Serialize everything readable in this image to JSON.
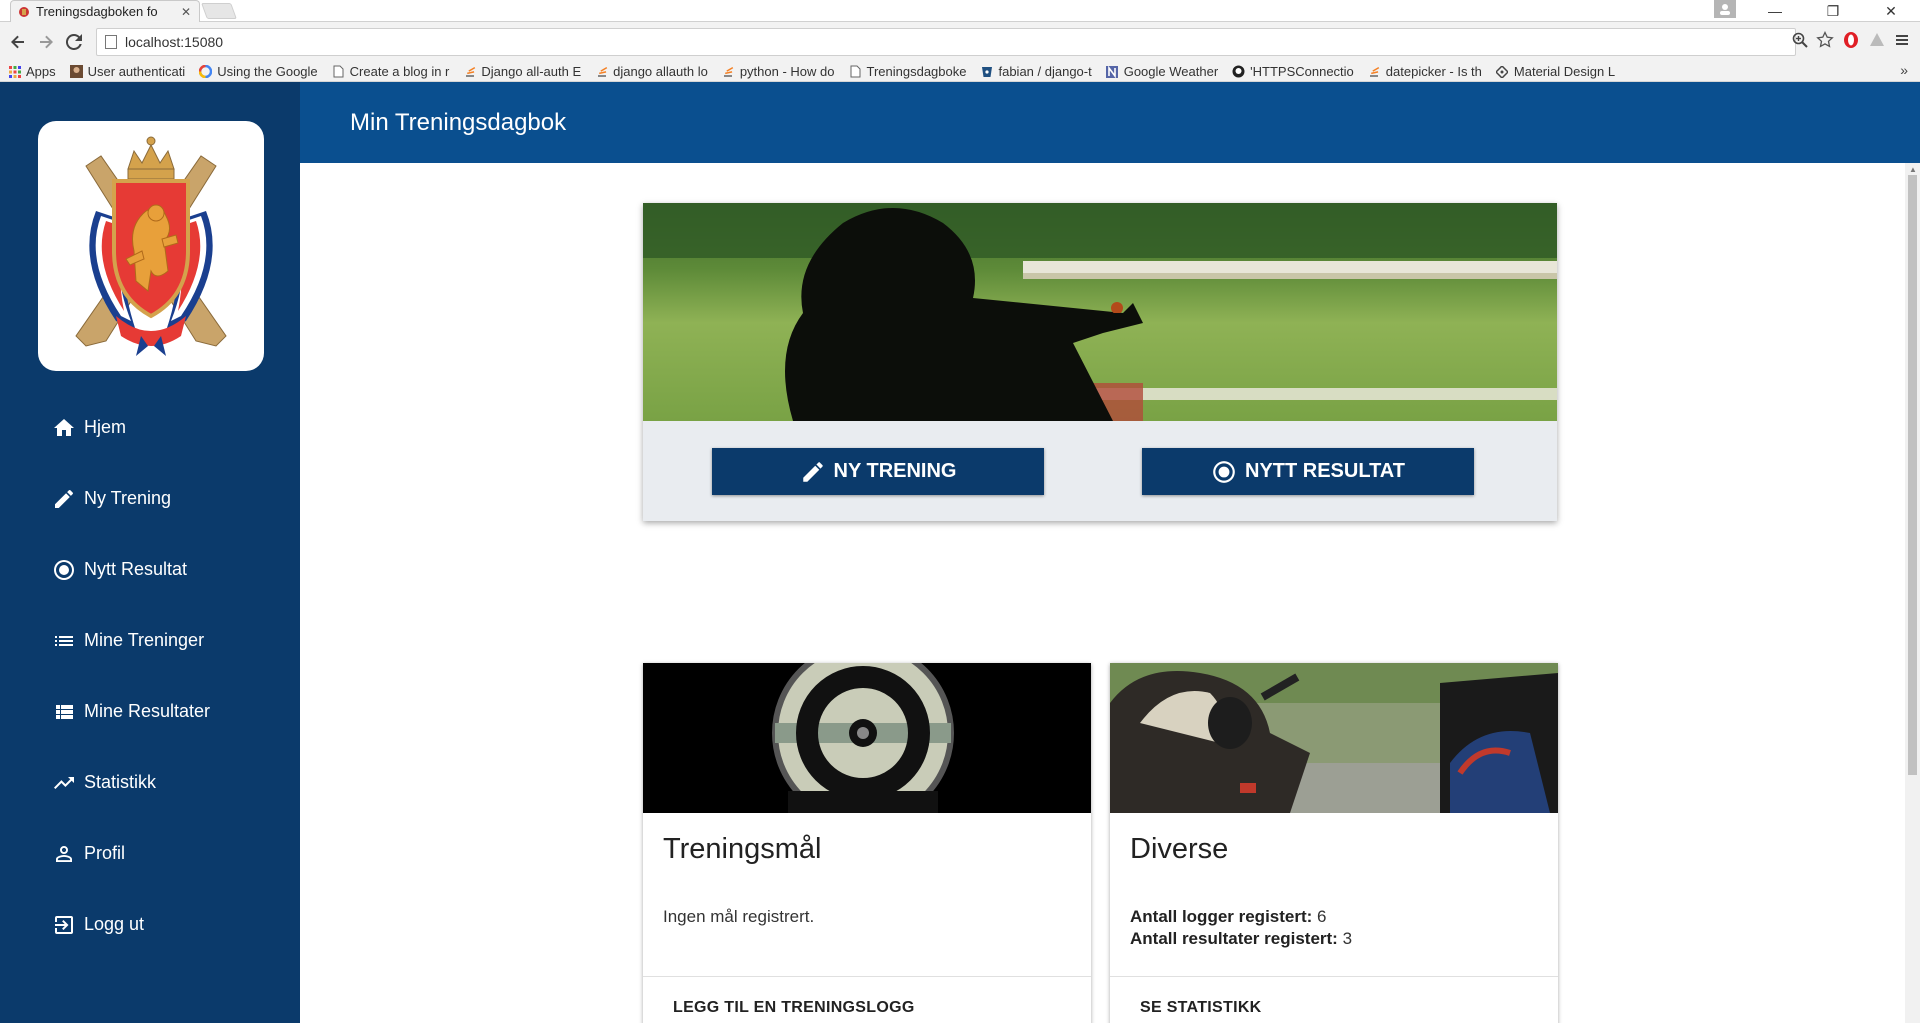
{
  "browser": {
    "tab_title": "Treningsdagboken fo",
    "url": "localhost:15080",
    "window_controls": [
      "—",
      "❐",
      "✕"
    ],
    "bookmarks": [
      {
        "icon": "apps-grid-icon",
        "label": "Apps"
      },
      {
        "icon": "user-avatar-icon",
        "label": "User authenticati"
      },
      {
        "icon": "google-icon",
        "label": "Using the Google"
      },
      {
        "icon": "page-icon",
        "label": "Create a blog in r"
      },
      {
        "icon": "stackoverflow-icon",
        "label": "Django all-auth E"
      },
      {
        "icon": "stackoverflow-icon",
        "label": "django allauth lo"
      },
      {
        "icon": "stackoverflow-icon",
        "label": "python - How do"
      },
      {
        "icon": "page-icon",
        "label": "Treningsdagboke"
      },
      {
        "icon": "bitbucket-icon",
        "label": "fabian / django-t"
      },
      {
        "icon": "n-icon",
        "label": "Google Weather"
      },
      {
        "icon": "github-icon",
        "label": "'HTTPSConnectio"
      },
      {
        "icon": "stackoverflow-icon",
        "label": "datepicker - Is th"
      },
      {
        "icon": "material-icon",
        "label": "Material Design L"
      }
    ],
    "bookmarks_more": "»"
  },
  "sidebar": {
    "items": [
      {
        "label": "Hjem",
        "icon": "home-icon"
      },
      {
        "label": "Ny Trening",
        "icon": "pencil-icon"
      },
      {
        "label": "Nytt Resultat",
        "icon": "target-icon"
      },
      {
        "label": "Mine Treninger",
        "icon": "list-icon"
      },
      {
        "label": "Mine Resultater",
        "icon": "table-icon"
      },
      {
        "label": "Statistikk",
        "icon": "trending-icon"
      },
      {
        "label": "Profil",
        "icon": "person-icon"
      },
      {
        "label": "Logg ut",
        "icon": "logout-icon"
      }
    ]
  },
  "header": {
    "title": "Min Treningsdagbok"
  },
  "hero": {
    "buttons": [
      {
        "label": "NY TRENING",
        "icon": "pencil-icon"
      },
      {
        "label": "NYTT RESULTAT",
        "icon": "target-icon"
      }
    ]
  },
  "cards": [
    {
      "title": "Treningsmål",
      "body": "Ingen mål registrert.",
      "action": "LEGG TIL EN TRENINGSLOGG"
    },
    {
      "title": "Diverse",
      "stats": [
        {
          "label": "Antall logger registert:",
          "value": "6"
        },
        {
          "label": "Antall resultater registert:",
          "value": "3"
        }
      ],
      "action": "SE STATISTIKK"
    }
  ],
  "colors": {
    "sidebar": "#0b3a6b",
    "topbar": "#0a4f8f",
    "button": "#0b3a6b"
  }
}
